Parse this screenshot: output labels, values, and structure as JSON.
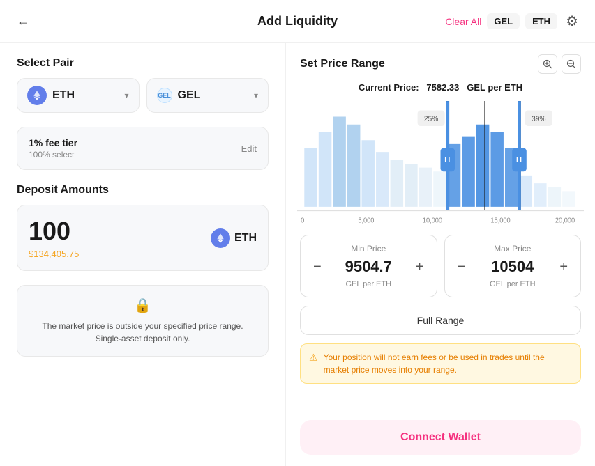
{
  "header": {
    "back_label": "←",
    "title": "Add Liquidity",
    "clear_all_label": "Clear All",
    "token1_badge": "GEL",
    "token2_badge": "ETH",
    "settings_icon": "⚙"
  },
  "left": {
    "select_pair_title": "Select Pair",
    "token1": {
      "name": "ETH",
      "icon_type": "eth"
    },
    "token2": {
      "name": "GEL",
      "icon_type": "gel",
      "icon_label": "GEL"
    },
    "fee_tier": {
      "label": "1% fee tier",
      "sub_label": "100% select",
      "edit_label": "Edit"
    },
    "deposit_title": "Deposit Amounts",
    "deposit": {
      "amount": "100",
      "token": "ETH",
      "usd": "$134,405.75"
    },
    "warning": {
      "text": "The market price is outside your specified price range. Single-asset deposit only."
    }
  },
  "right": {
    "set_price_range_title": "Set Price Range",
    "zoom_in_icon": "⊕",
    "zoom_out_icon": "⊖",
    "current_price_label": "Current Price:",
    "current_price_value": "7582.33",
    "current_price_unit": "GEL per ETH",
    "chart": {
      "x_labels": [
        "0",
        "5,000",
        "10,000",
        "15,000",
        "20,000"
      ],
      "range_left_pct": "25%",
      "range_right_pct": "39%"
    },
    "min_price": {
      "label": "Min Price",
      "value": "9504.7",
      "unit": "GEL per ETH"
    },
    "max_price": {
      "label": "Max Price",
      "value": "10504",
      "unit": "GEL per ETH"
    },
    "full_range_label": "Full Range",
    "warning_text": "Your position will not earn fees or be used in trades until the market price moves into your range.",
    "connect_wallet_label": "Connect Wallet"
  }
}
